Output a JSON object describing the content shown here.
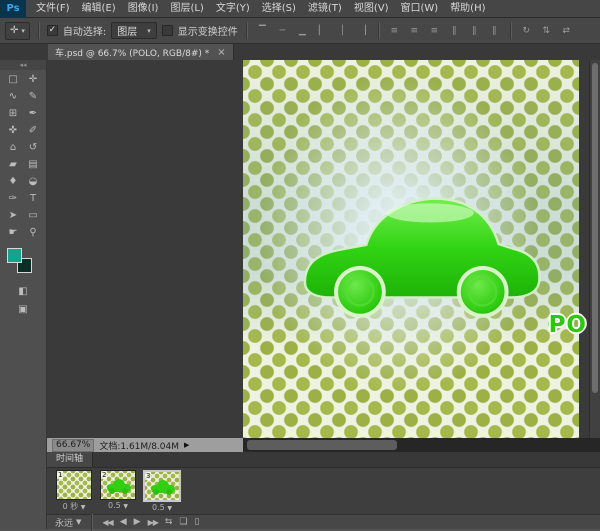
{
  "menu_bar": {
    "logo": "Ps",
    "items": [
      {
        "label": "文件(F)"
      },
      {
        "label": "编辑(E)"
      },
      {
        "label": "图像(I)"
      },
      {
        "label": "图层(L)"
      },
      {
        "label": "文字(Y)"
      },
      {
        "label": "选择(S)"
      },
      {
        "label": "滤镜(T)"
      },
      {
        "label": "视图(V)"
      },
      {
        "label": "窗口(W)"
      },
      {
        "label": "帮助(H)"
      }
    ]
  },
  "options_bar": {
    "tool_icon": "✛",
    "caret": "▾",
    "auto_select_check": "✓",
    "auto_select_label": "自动选择:",
    "layer_dropdown_value": "图层",
    "show_transform_label": "显示变换控件",
    "align_icons": [
      "▔",
      "─",
      "▁",
      "▏",
      "│",
      "▕"
    ],
    "distribute_icons": [
      "≡",
      "≡",
      "≡",
      "∥",
      "∥",
      "∥"
    ],
    "mode_icons": [
      "↻",
      "⇅",
      "⇄"
    ]
  },
  "document_tab": {
    "title": "车.psd @ 66.7% (POLO, RGB/8#) *",
    "close_icon": "×"
  },
  "toolbar": {
    "collapse_icon": "◂◂",
    "tools": [
      {
        "name": "rectangular-marquee",
        "glyph": "□"
      },
      {
        "name": "move",
        "glyph": "✛"
      },
      {
        "name": "lasso",
        "glyph": "∿"
      },
      {
        "name": "quick-selection",
        "glyph": "✎"
      },
      {
        "name": "crop",
        "glyph": "⊞"
      },
      {
        "name": "eyedropper",
        "glyph": "✒"
      },
      {
        "name": "healing-brush",
        "glyph": "✜"
      },
      {
        "name": "brush",
        "glyph": "✐"
      },
      {
        "name": "clone-stamp",
        "glyph": "⌂"
      },
      {
        "name": "history-brush",
        "glyph": "↺"
      },
      {
        "name": "eraser",
        "glyph": "▰"
      },
      {
        "name": "gradient",
        "glyph": "▤"
      },
      {
        "name": "blur",
        "glyph": "♦"
      },
      {
        "name": "dodge",
        "glyph": "◒"
      },
      {
        "name": "pen",
        "glyph": "✑"
      },
      {
        "name": "type",
        "glyph": "T"
      },
      {
        "name": "path-selection",
        "glyph": "➤"
      },
      {
        "name": "shape",
        "glyph": "▭"
      },
      {
        "name": "hand",
        "glyph": "☛"
      },
      {
        "name": "zoom",
        "glyph": "⚲"
      }
    ],
    "foreground_color": "#18a18c",
    "background_color": "#0b2d26",
    "quick_mask_icon": "◧",
    "screen_mode_icon": "▣"
  },
  "canvas": {
    "watermark": "PO",
    "dot_color": "#a6b84c",
    "car_color": "#2ecb10",
    "glow_color": "#e4f0f6"
  },
  "status_bar": {
    "zoom": "66.67%",
    "doc_label": "文档:1.61M/8.04M",
    "flyout_icon": "▶"
  },
  "timeline": {
    "tab_label": "时间轴",
    "caret": "▼",
    "frames": [
      {
        "number": "1",
        "delay": "0 秒"
      },
      {
        "number": "2",
        "delay": "0.5"
      },
      {
        "number": "3",
        "delay": "0.5"
      }
    ],
    "loop_label": "永远",
    "controls": [
      {
        "name": "first-frame",
        "glyph": "◀◀"
      },
      {
        "name": "previous-frame",
        "glyph": "◀"
      },
      {
        "name": "play",
        "glyph": "▶"
      },
      {
        "name": "next-frame",
        "glyph": "▶▶"
      },
      {
        "name": "tween",
        "glyph": "⇆"
      },
      {
        "name": "duplicate-frame",
        "glyph": "❏"
      },
      {
        "name": "delete-frame",
        "glyph": "▯"
      }
    ]
  }
}
